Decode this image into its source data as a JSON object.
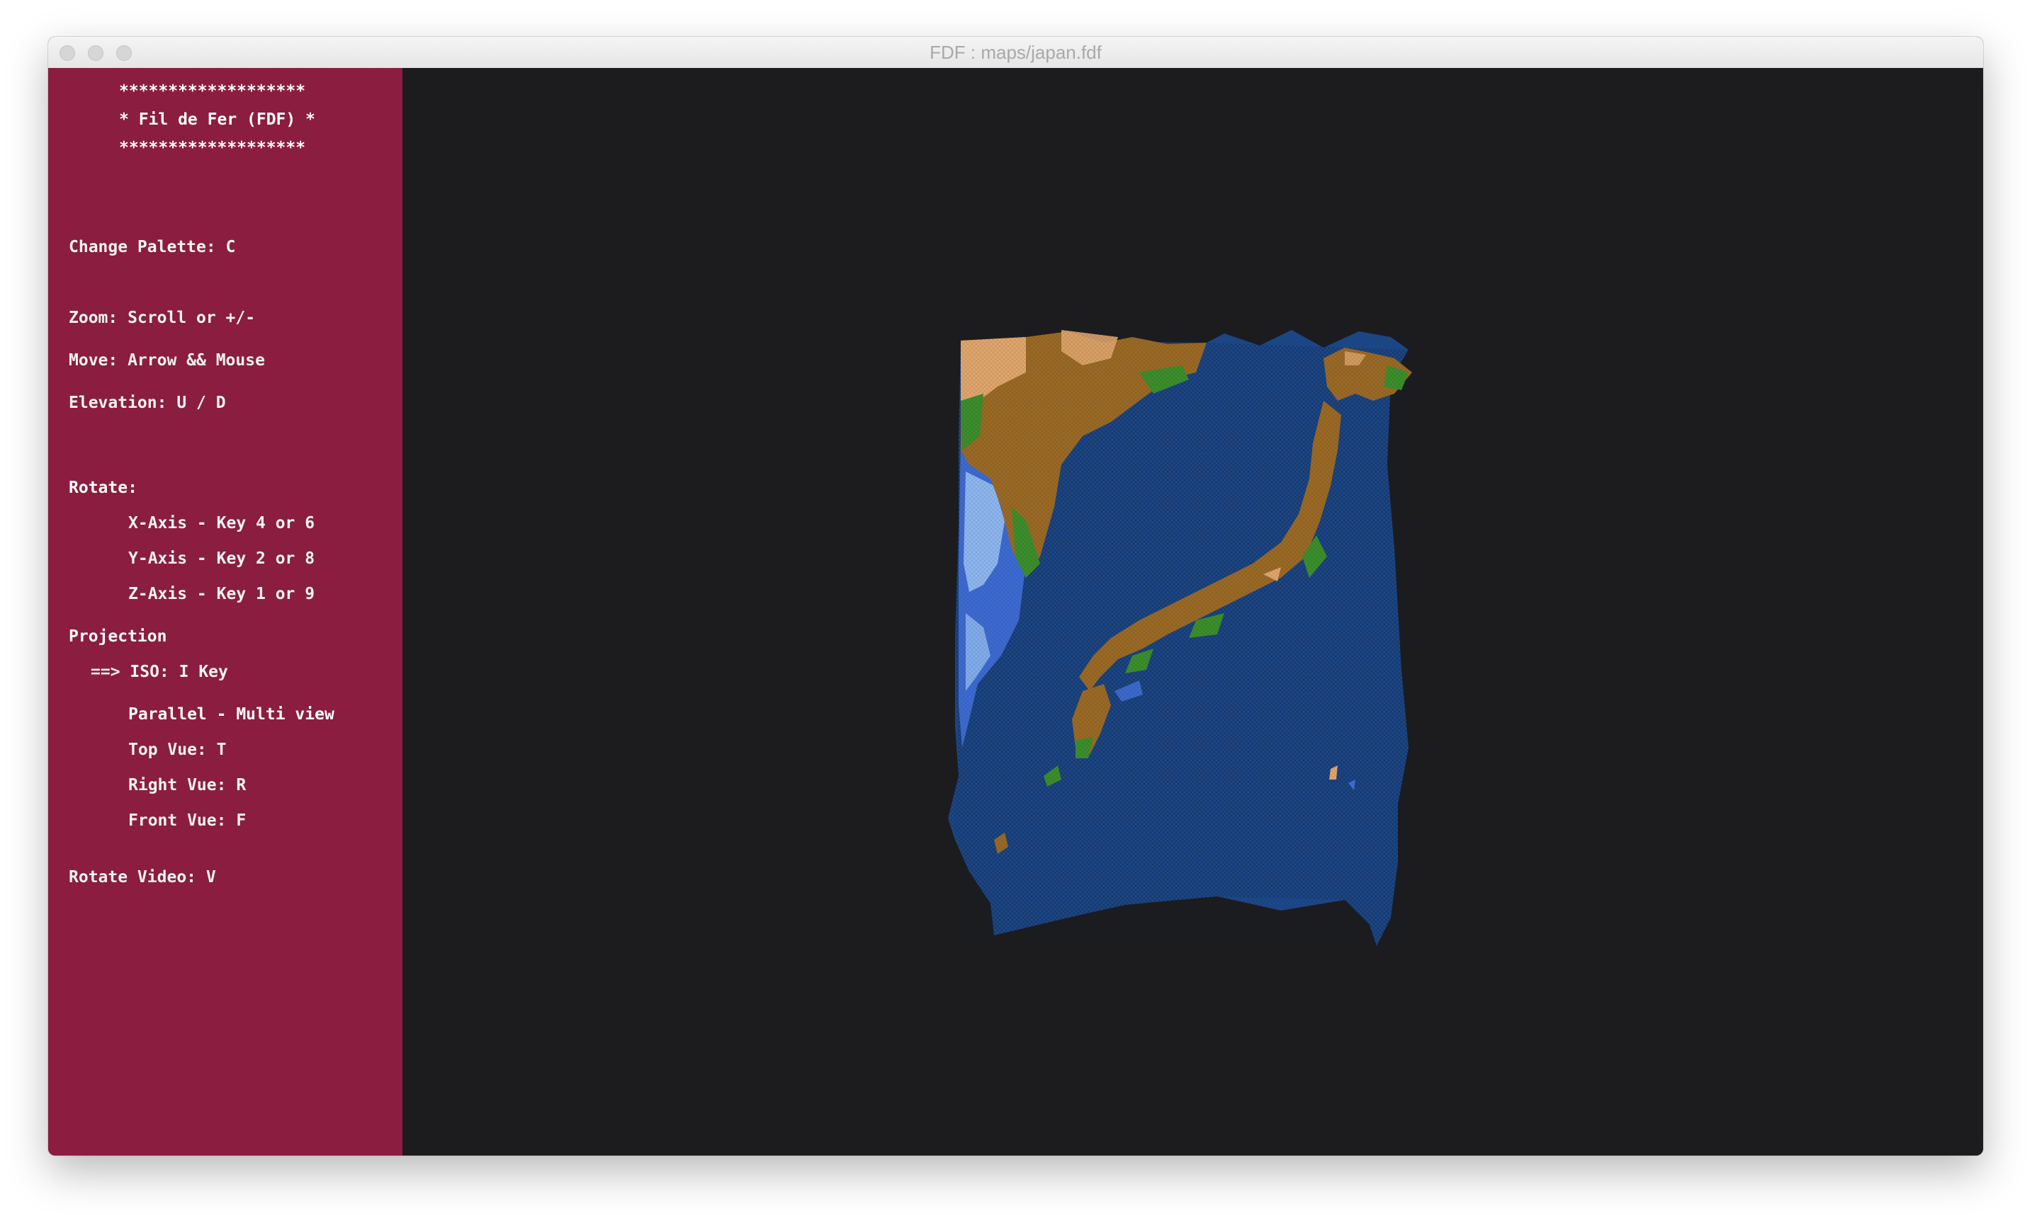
{
  "window": {
    "title": "FDF : maps/japan.fdf"
  },
  "sidebar": {
    "banner_top": "*******************",
    "banner_title": "* Fil de Fer (FDF) *",
    "banner_bottom": "*******************",
    "change_palette": "Change Palette: C",
    "zoom": "Zoom: Scroll or +/-",
    "move": "Move: Arrow && Mouse",
    "elevation": "Elevation: U / D",
    "rotate_header": "Rotate:",
    "rotate_x": "X-Axis - Key 4 or 6",
    "rotate_y": "Y-Axis - Key 2 or 8",
    "rotate_z": "Z-Axis - Key 1 or 9",
    "projection_header": "Projection",
    "projection_iso": "==> ISO: I Key",
    "projection_parallel": "Parallel - Multi view",
    "top_view": "Top Vue: T",
    "right_view": "Right Vue: R",
    "front_view": "Front Vue: F",
    "rotate_video": "Rotate Video: V",
    "colors": {
      "background": "#8a1d40",
      "text": "#f3f3f3"
    }
  },
  "viewport": {
    "background": "#1c1c1e",
    "terrain_palette": {
      "deep_sea": "#173d7a",
      "sea": "#1f4a8c",
      "shallow": "#3f6fd6",
      "coast": "#8fb8f0",
      "lowland": "#3c8f2a",
      "highland": "#9c6a23",
      "peak": "#e3a76c"
    }
  }
}
